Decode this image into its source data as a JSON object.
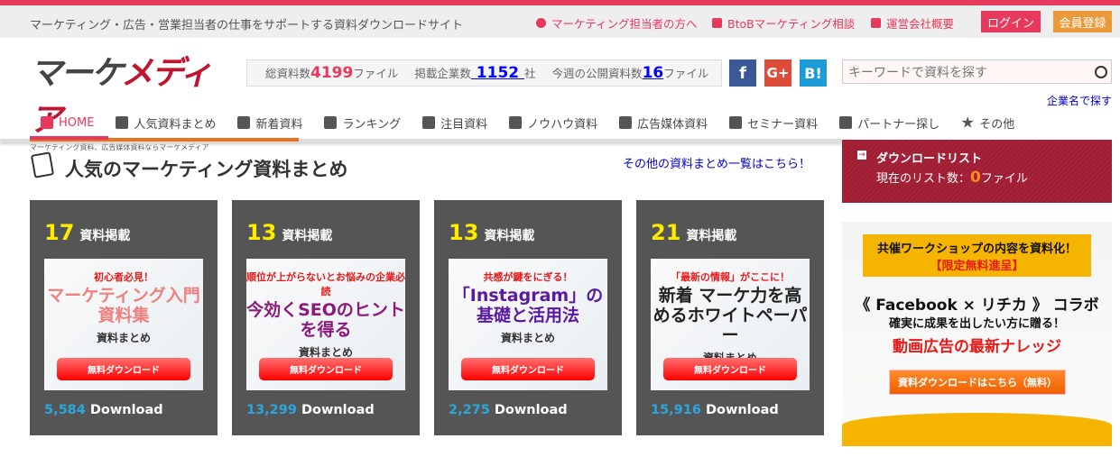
{
  "topbar": {
    "tagline": "マーケティング・広告・営業担当者の仕事をサポートする資料ダウンロードサイト",
    "links": [
      {
        "label": "マーケティング担当者の方へ"
      },
      {
        "label": "BtoBマーケティング相談"
      },
      {
        "label": "運営会社概要"
      }
    ],
    "login": "ログイン",
    "register": "会員登録"
  },
  "logo": {
    "main_a": "マーケ",
    "main_b": "メディア",
    "sub": "マーケティング資料、広告媒体資料ならマーケメディア"
  },
  "stats": {
    "total_label": "総資料数",
    "total": "4199",
    "total_unit": "ファイル",
    "companies_label": "掲載企業数",
    "companies": " 1152 ",
    "companies_unit": "社",
    "week_label": "今週の公開資料数",
    "week": "16",
    "week_unit": "ファイル"
  },
  "social": {
    "facebook": "f",
    "google": "G+",
    "hatena": "B!"
  },
  "search": {
    "placeholder": "キーワードで資料を探す",
    "company_link": "企業名で探す"
  },
  "nav": [
    {
      "label": "HOME"
    },
    {
      "label": "人気資料まとめ"
    },
    {
      "label": "新着資料"
    },
    {
      "label": "ランキング"
    },
    {
      "label": "注目資料"
    },
    {
      "label": "ノウハウ資料"
    },
    {
      "label": "広告媒体資料"
    },
    {
      "label": "セミナー資料"
    },
    {
      "label": "パートナー探し"
    },
    {
      "label": "その他"
    }
  ],
  "section": {
    "title": "人気のマーケティング資料まとめ",
    "more_link": "その他の資料まとめ一覧はこちら！"
  },
  "cards": [
    {
      "count": "17",
      "count_label": "資料掲載",
      "t1": "初心者必見！",
      "t2": "マーケティング入門資料集",
      "t2color": "#f08080",
      "t3": "資料まとめ",
      "button": "無料ダウンロード",
      "downloads": "5,584",
      "dl_label": "Download"
    },
    {
      "count": "13",
      "count_label": "資料掲載",
      "t1": "順位が上がらないとお悩みの企業必読",
      "t2": "今効くSEOのヒントを得る",
      "t2color": "#8b1a7a",
      "t3": "資料まとめ",
      "button": "無料ダウンロード",
      "downloads": "13,299",
      "dl_label": "Download"
    },
    {
      "count": "13",
      "count_label": "資料掲載",
      "t1": "共感が鍵をにぎる！",
      "t2": "「Instagram」の基礎と活用法",
      "t2color": "#5a1aa0",
      "t3": "資料まとめ",
      "button": "無料ダウンロード",
      "downloads": "2,275",
      "dl_label": "Download"
    },
    {
      "count": "21",
      "count_label": "資料掲載",
      "t1": "「最新の情報」がここに！",
      "t2": "新着 マーケ力を高めるホワイトペーパー",
      "t2color": "#222",
      "t3": "資料まとめ",
      "button": "無料ダウンロード",
      "downloads": "15,916",
      "dl_label": "Download"
    }
  ],
  "download_list": {
    "title": "ダウンロードリスト",
    "count_label": "現在のリスト数：",
    "count": "0",
    "unit": "ファイル"
  },
  "ad": {
    "box_a": "共催ワークショップの内容を資料化！",
    "box_b": "【限定無料進呈】",
    "l1": "《 Facebook × リチカ 》 コラボ",
    "l2": "確実に成果を出したい方に贈る！",
    "l3": "動画広告の最新ナレッジ",
    "cta": "資料ダウンロードはこちら（無料）"
  }
}
